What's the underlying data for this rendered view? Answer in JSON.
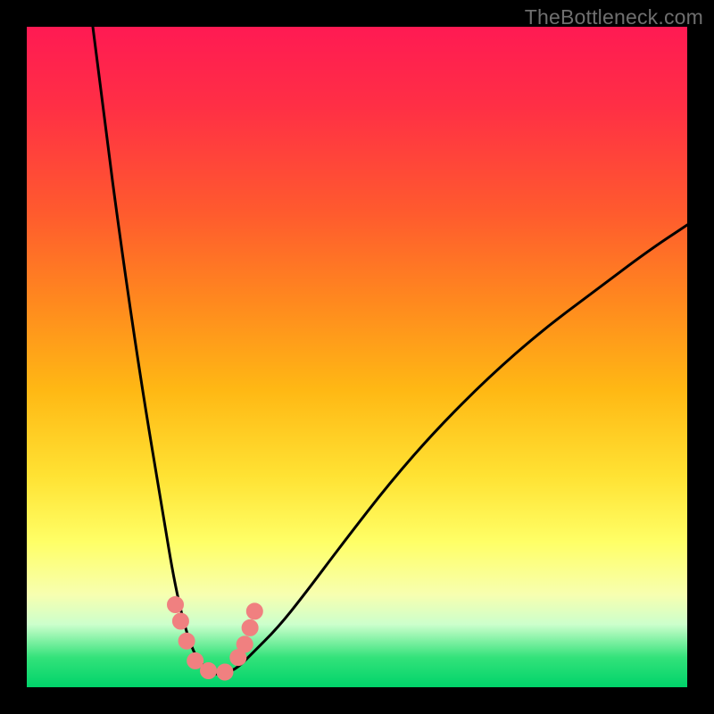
{
  "watermark": "TheBottleneck.com",
  "colors": {
    "frame": "#000000",
    "curve": "#000000",
    "marker_fill": "#f08080",
    "marker_stroke": "#f08080",
    "gradient_stops": [
      {
        "offset": 0.0,
        "color": "#ff1a53"
      },
      {
        "offset": 0.12,
        "color": "#ff2f45"
      },
      {
        "offset": 0.28,
        "color": "#ff5a2e"
      },
      {
        "offset": 0.42,
        "color": "#ff8a1e"
      },
      {
        "offset": 0.55,
        "color": "#ffb814"
      },
      {
        "offset": 0.68,
        "color": "#ffe233"
      },
      {
        "offset": 0.78,
        "color": "#ffff66"
      },
      {
        "offset": 0.86,
        "color": "#f7ffb0"
      },
      {
        "offset": 0.905,
        "color": "#ccffcc"
      },
      {
        "offset": 0.955,
        "color": "#33e27a"
      },
      {
        "offset": 1.0,
        "color": "#00d36a"
      }
    ]
  },
  "chart_data": {
    "type": "line",
    "title": "",
    "xlabel": "",
    "ylabel": "",
    "xlim": [
      0,
      100
    ],
    "ylim": [
      0,
      100
    ],
    "series": [
      {
        "name": "bottleneck-curve",
        "x": [
          10,
          12,
          14,
          16,
          18,
          20,
          21,
          22,
          23,
          24,
          25,
          26,
          28,
          30,
          32,
          34,
          38,
          42,
          48,
          55,
          62,
          70,
          78,
          86,
          94,
          100
        ],
        "values": [
          100,
          84,
          69,
          55,
          42,
          30,
          24,
          18,
          13,
          9,
          6,
          4,
          2,
          2,
          3,
          5,
          9,
          14,
          22,
          31,
          39,
          47,
          54,
          60,
          66,
          70
        ]
      }
    ],
    "markers": [
      {
        "x": 22.5,
        "y": 12.5
      },
      {
        "x": 23.3,
        "y": 10.0
      },
      {
        "x": 24.2,
        "y": 7.0
      },
      {
        "x": 25.5,
        "y": 4.0
      },
      {
        "x": 27.5,
        "y": 2.5
      },
      {
        "x": 30.0,
        "y": 2.3
      },
      {
        "x": 32.0,
        "y": 4.5
      },
      {
        "x": 33.0,
        "y": 6.5
      },
      {
        "x": 33.8,
        "y": 9.0
      },
      {
        "x": 34.5,
        "y": 11.5
      }
    ],
    "marker_radius_px": 9
  }
}
